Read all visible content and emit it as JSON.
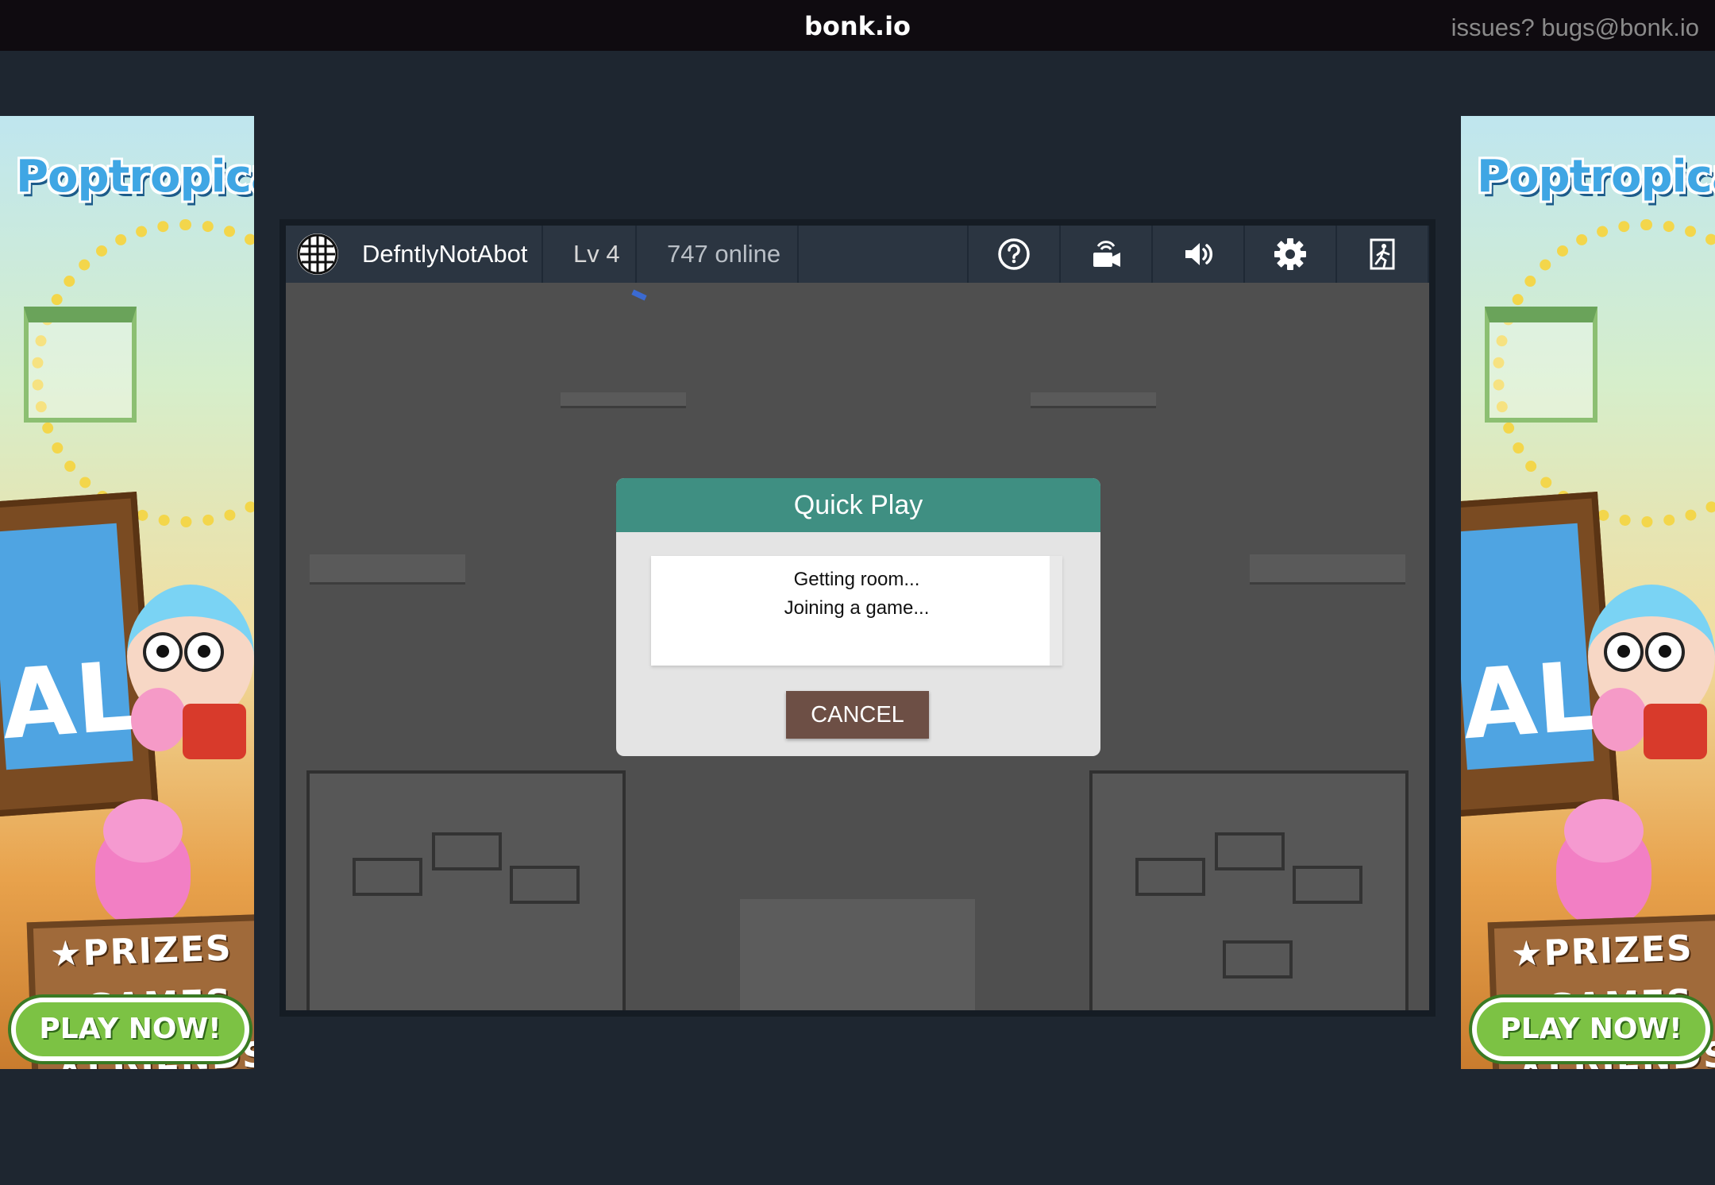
{
  "topbar": {
    "title": "bonk.io",
    "contact": "issues? bugs@bonk.io"
  },
  "ad": {
    "logo": "Poptropica",
    "sign_text": "AL",
    "lines": [
      "★PRIZES",
      "★GAMES",
      "★FRIENDS"
    ],
    "cta": "PLAY NOW!"
  },
  "toolbar": {
    "username": "DefntlyNotAbot",
    "level": "Lv 4",
    "online": "747 online",
    "icons": [
      "help-icon",
      "camera-icon",
      "speaker-icon",
      "gear-icon",
      "exit-icon"
    ]
  },
  "dialog": {
    "title": "Quick Play",
    "messages": [
      "Getting room...",
      "Joining a game..."
    ],
    "cancel_label": "CANCEL"
  },
  "colors": {
    "page_bg": "#1e2630",
    "topbar_bg": "#0f0b10",
    "toolbar_bg": "#2b3541",
    "map_bg": "#4f4f4f",
    "dialog_header": "#3f8f82",
    "cancel_button": "#6d4f45"
  }
}
